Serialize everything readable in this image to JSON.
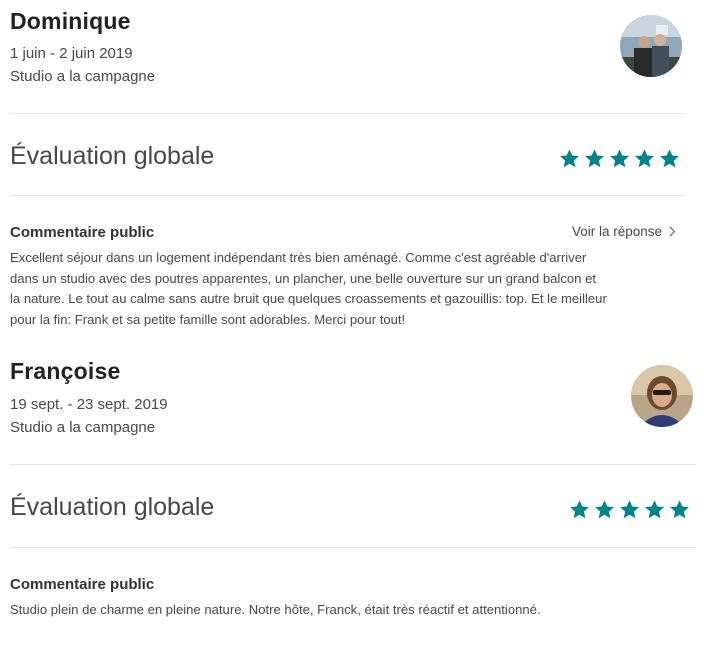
{
  "reviews": [
    {
      "name": "Dominique",
      "dates": "1 juin - 2 juin 2019",
      "listing": "Studio a la campagne",
      "rating_label": "Évaluation globale",
      "stars": 5,
      "comment_title": "Commentaire public",
      "reply_link": "Voir la réponse",
      "comment_lines": [
        "Excellent séjour dans un logement indépendant très bien aménagé. Comme c'est agréable d'arriver",
        "dans un studio avec des poutres apparentes, un plancher, une belle ouverture sur un grand balcon et",
        "la nature. Le tout au calme sans autre bruit que quelques croassements et gazouillis: top. Et le meilleur",
        "pour la fin: Frank et sa petite famille sont adorables. Merci pour tout!"
      ]
    },
    {
      "name": "Françoise",
      "dates": "19 sept. - 23 sept. 2019",
      "listing": "Studio a la campagne",
      "rating_label": "Évaluation globale",
      "stars": 5,
      "comment_title": "Commentaire public",
      "comment_lines": [
        "Studio plein de charme en pleine nature. Notre hôte, Franck, était très réactif et attentionné."
      ]
    }
  ],
  "colors": {
    "star": "#008489",
    "text": "#484848",
    "divider": "#e4e4e4"
  },
  "icons": {
    "star": "star-icon",
    "chevron": "chevron-right-icon"
  }
}
